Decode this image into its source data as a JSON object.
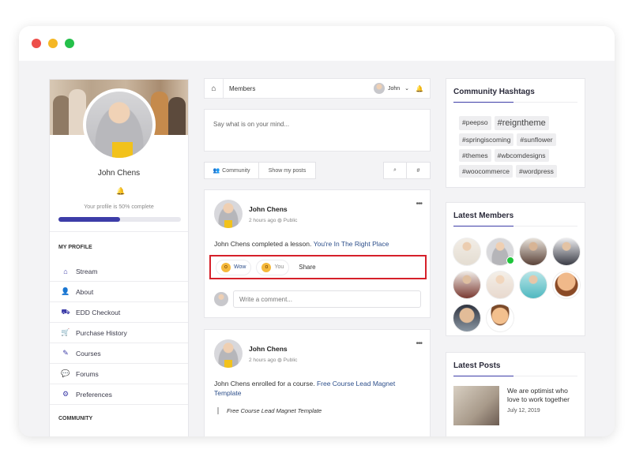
{
  "window": {
    "controls": [
      "close",
      "minimize",
      "maximize"
    ]
  },
  "profile": {
    "name": "John Chens",
    "completion_text": "Your profile is 50% complete",
    "completion_fraction": 0.5,
    "my_profile_label": "MY PROFILE",
    "menu": [
      {
        "icon": "home-icon",
        "glyph": "⌂",
        "label": "Stream"
      },
      {
        "icon": "user-icon",
        "glyph": "👤",
        "label": "About"
      },
      {
        "icon": "truck-icon",
        "glyph": "⛟",
        "label": "EDD Checkout"
      },
      {
        "icon": "cart-icon",
        "glyph": "🛒",
        "label": "Purchase History"
      },
      {
        "icon": "edit-icon",
        "glyph": "✎",
        "label": "Courses"
      },
      {
        "icon": "chat-icon",
        "glyph": "💬",
        "label": "Forums"
      },
      {
        "icon": "gear-icon",
        "glyph": "⚙",
        "label": "Preferences"
      }
    ],
    "community_label": "COMMUNITY"
  },
  "topnav": {
    "section": "Members",
    "user": "John"
  },
  "composer": {
    "placeholder": "Say what is on your mind..."
  },
  "filters": {
    "community": "Community",
    "show_my_posts": "Show my posts"
  },
  "posts": [
    {
      "author": "John Chens",
      "time": "2 hours ago",
      "visibility": "Public",
      "text_prefix": "John Chens completed a lesson.",
      "link": "You're In The Right Place",
      "reactions": {
        "wow": "Wow",
        "you": "You",
        "share": "Share"
      },
      "comment_placeholder": "Write a comment..."
    },
    {
      "author": "John Chens",
      "time": "2 hours ago",
      "visibility": "Public",
      "text_prefix": "John Chens enrolled for a course.",
      "link": "Free Course Lead Magnet Template",
      "quote": "Free Course Lead Magnet Template"
    }
  ],
  "hashtags": {
    "title": "Community Hashtags",
    "tags": [
      "#peepso",
      "#reigntheme",
      "#springiscoming",
      "#sunflower",
      "#themes",
      "#wbcomdesigns",
      "#woocommerce",
      "#wordpress"
    ]
  },
  "latest_members": {
    "title": "Latest Members",
    "count": 10
  },
  "latest_posts": {
    "title": "Latest Posts",
    "item_title": "We are optimist who love to work together",
    "item_date": "July 12, 2019"
  },
  "colors": {
    "accent": "#3d3da8",
    "highlight": "#d6202a",
    "link": "#2d4f8b",
    "online": "#1ec43a"
  }
}
